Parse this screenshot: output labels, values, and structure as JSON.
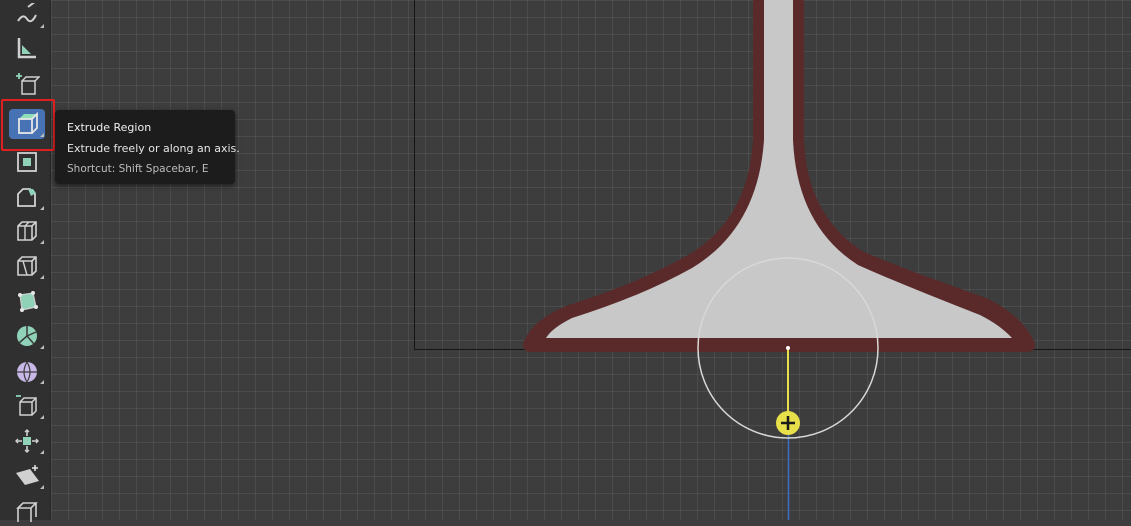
{
  "tooltip": {
    "title": "Extrude Region",
    "description": "Extrude freely or along an axis.",
    "shortcut": "Shortcut: Shift Spacebar, E"
  },
  "toolbar": {
    "tools": [
      {
        "icon": "annotate-icon",
        "active": false
      },
      {
        "icon": "measure-icon",
        "active": false
      },
      {
        "icon": "add-cube-icon",
        "active": false
      },
      {
        "icon": "extrude-region-icon",
        "active": true
      },
      {
        "icon": "inset-faces-icon",
        "active": false
      },
      {
        "icon": "bevel-icon",
        "active": false
      },
      {
        "icon": "loop-cut-icon",
        "active": false
      },
      {
        "icon": "knife-icon",
        "active": false
      },
      {
        "icon": "poly-build-icon",
        "active": false
      },
      {
        "icon": "spin-icon",
        "active": false
      },
      {
        "icon": "smooth-icon",
        "active": false
      },
      {
        "icon": "edge-slide-icon",
        "active": false
      },
      {
        "icon": "shrink-fatten-icon",
        "active": false
      },
      {
        "icon": "shear-icon",
        "active": false
      },
      {
        "icon": "rip-region-icon",
        "active": false
      }
    ]
  },
  "colors": {
    "viewport_bg": "#3d3d3d",
    "toolbar_bg": "#303030",
    "active_tool": "#4772b3",
    "highlight_box": "#e02020",
    "mesh_fill": "#c8c8c8",
    "mesh_outline": "#5a2a2a",
    "cursor_yellow": "#e8e04a",
    "axis_blue": "#3b6fc4"
  }
}
